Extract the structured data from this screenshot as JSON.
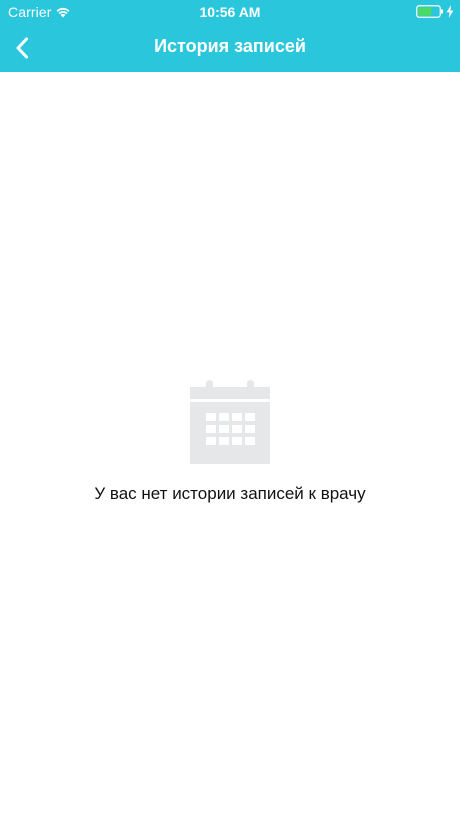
{
  "status_bar": {
    "carrier": "Carrier",
    "time": "10:56 AM",
    "wifi_icon": "wifi-icon",
    "battery_icon": "battery-icon",
    "charging_icon": "bolt-icon"
  },
  "nav": {
    "back_icon": "chevron-left-icon",
    "title": "История записей"
  },
  "empty_state": {
    "icon": "calendar-icon",
    "message": "У вас нет истории записей к врачу"
  },
  "colors": {
    "header_bg": "#2ac6dc",
    "header_text": "#ffffff",
    "page_bg": "#ffffff",
    "icon_gray": "#e6e7e9",
    "battery_fill": "#4cd964",
    "message_text": "#111111"
  }
}
